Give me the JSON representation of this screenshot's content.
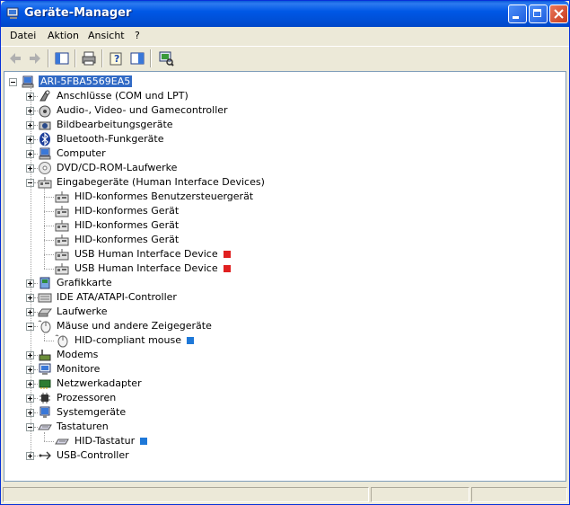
{
  "window": {
    "title": "Geräte-Manager"
  },
  "menu": {
    "items": [
      "Datei",
      "Aktion",
      "Ansicht",
      "?"
    ]
  },
  "tree": {
    "root": "ARI-5FBA5569EA5",
    "rows": [
      {
        "label": "Anschlüsse (COM und LPT)",
        "icon": "port-icon"
      },
      {
        "label": "Audio-, Video- und Gamecontroller",
        "icon": "audio-icon"
      },
      {
        "label": "Bildbearbeitungsgeräte",
        "icon": "camera-icon"
      },
      {
        "label": "Bluetooth-Funkgeräte",
        "icon": "bluetooth-icon"
      },
      {
        "label": "Computer",
        "icon": "computer-icon"
      },
      {
        "label": "DVD/CD-ROM-Laufwerke",
        "icon": "cdrom-icon"
      },
      {
        "label": "Eingabegeräte (Human Interface Devices)",
        "icon": "hid-icon"
      },
      {
        "label": "HID-konformes Benutzersteuergerät",
        "icon": "hid-icon"
      },
      {
        "label": "HID-konformes Gerät",
        "icon": "hid-icon"
      },
      {
        "label": "HID-konformes Gerät",
        "icon": "hid-icon"
      },
      {
        "label": "HID-konformes Gerät",
        "icon": "hid-icon"
      },
      {
        "label": "USB Human Interface Device",
        "icon": "hid-icon",
        "marker": "#e02020"
      },
      {
        "label": "USB Human Interface Device",
        "icon": "hid-icon",
        "marker": "#e02020"
      },
      {
        "label": "Grafikkarte",
        "icon": "display-icon"
      },
      {
        "label": "IDE ATA/ATAPI-Controller",
        "icon": "ide-icon"
      },
      {
        "label": "Laufwerke",
        "icon": "drive-icon"
      },
      {
        "label": "Mäuse und andere Zeigegeräte",
        "icon": "mouse-icon"
      },
      {
        "label": "HID-compliant mouse",
        "icon": "mouse-icon",
        "marker": "#1e78d8"
      },
      {
        "label": "Modems",
        "icon": "modem-icon"
      },
      {
        "label": "Monitore",
        "icon": "monitor-icon"
      },
      {
        "label": "Netzwerkadapter",
        "icon": "network-icon"
      },
      {
        "label": "Prozessoren",
        "icon": "cpu-icon"
      },
      {
        "label": "Systemgeräte",
        "icon": "system-icon"
      },
      {
        "label": "Tastaturen",
        "icon": "keyboard-icon"
      },
      {
        "label": "HID-Tastatur",
        "icon": "keyboard-icon",
        "marker": "#1e78d8"
      },
      {
        "label": "USB-Controller",
        "icon": "usb-icon"
      }
    ]
  }
}
